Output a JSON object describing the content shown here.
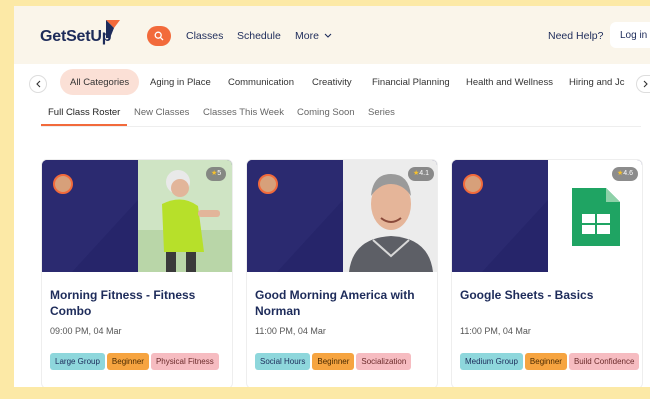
{
  "header": {
    "logo": "GetSetUp",
    "nav": [
      "Classes",
      "Schedule",
      "More"
    ],
    "help": "Need Help?",
    "login": "Log in"
  },
  "categories": [
    "All Categories",
    "Aging in Place",
    "Communication",
    "Creativity",
    "Financial Planning",
    "Health and Wellness",
    "Hiring and Jc"
  ],
  "subtabs": [
    "Full Class Roster",
    "New Classes",
    "Classes This Week",
    "Coming Soon",
    "Series"
  ],
  "cards": [
    {
      "rating": "5",
      "title": "Morning Fitness - Fitness Combo",
      "time": "09:00 PM, 04 Mar",
      "tags": [
        "Large Group",
        "Beginner",
        "Physical Fitness"
      ]
    },
    {
      "rating": "4.1",
      "title": "Good Morning America with Norman",
      "time": "11:00 PM, 04 Mar",
      "tags": [
        "Social Hours",
        "Beginner",
        "Socialization"
      ]
    },
    {
      "rating": "4.6",
      "title": "Google Sheets - Basics",
      "time": "11:00 PM, 04 Mar",
      "tags": [
        "Medium Group",
        "Beginner",
        "Build Confidence"
      ]
    }
  ],
  "colors": {
    "accent": "#f26a3b",
    "navy": "#1d2b5a",
    "card_media": "#2b2a70",
    "page_bg": "#fce9a6",
    "tag_teal": "#8ed7dc",
    "tag_orange": "#f6a440",
    "tag_pink": "#f6bcc1"
  },
  "icons": [
    "logo-flag-icon",
    "search-icon",
    "chevron-down-icon",
    "chevron-left-icon",
    "chevron-right-icon",
    "star-icon",
    "google-sheets-icon"
  ]
}
